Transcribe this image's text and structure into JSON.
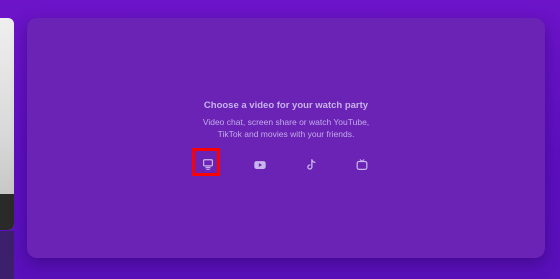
{
  "watch_party": {
    "title": "Choose a video for your watch party",
    "description_line1": "Video chat, screen share or watch YouTube,",
    "description_line2": "TikTok and movies with your friends."
  },
  "options": [
    {
      "icon": "screen-share-icon",
      "selected": true
    },
    {
      "icon": "youtube-icon",
      "selected": false
    },
    {
      "icon": "tiktok-icon",
      "selected": false
    },
    {
      "icon": "tv-icon",
      "selected": false
    }
  ],
  "colors": {
    "background": "#6d14c9",
    "panel": "#6a23b5",
    "text": "#c8b3ec",
    "icon": "#c9b6ec",
    "highlight": "#ff0000"
  }
}
